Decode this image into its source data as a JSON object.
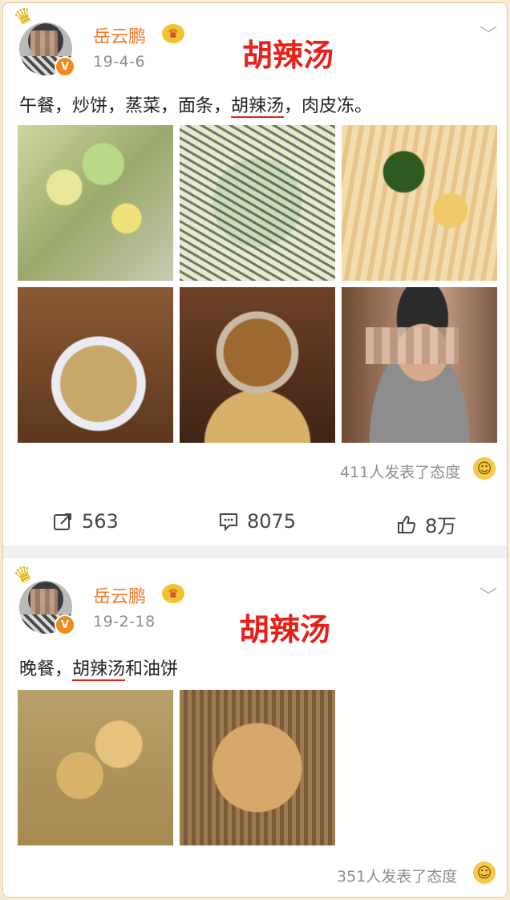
{
  "posts": [
    {
      "username": "岳云鹏",
      "date": "19-4-6",
      "overlay_title": "胡辣汤",
      "text_before": "午餐，炒饼，蒸菜，面条，",
      "text_highlight": "胡辣汤",
      "text_after": "，肉皮冻。",
      "photos": [
        "salad",
        "rice-greens",
        "noodles",
        "soup",
        "vegetables",
        "selfie"
      ],
      "reactions_text": "411人发表了态度",
      "actions": {
        "repost": "563",
        "comment": "8075",
        "like": "8万"
      }
    },
    {
      "username": "岳云鹏",
      "date": "19-2-18",
      "overlay_title": "胡辣汤",
      "text_before": "晚餐，",
      "text_highlight": "胡辣汤",
      "text_after": "和油饼",
      "photos": [
        "soup",
        "fried-pancake"
      ],
      "reactions_text": "351人发表了态度"
    }
  ],
  "icons": {
    "crown": "crown-icon",
    "verified": "verified-badge-icon",
    "chevron": "chevron-down-icon",
    "repost": "repost-icon",
    "comment": "comment-icon",
    "like": "thumbs-up-icon",
    "emoji": "laugh-emoji-icon"
  },
  "colors": {
    "username": "#ee7a2a",
    "overlay": "#e8201a",
    "verified": "#f08a1c",
    "border": "#e8c98c"
  }
}
